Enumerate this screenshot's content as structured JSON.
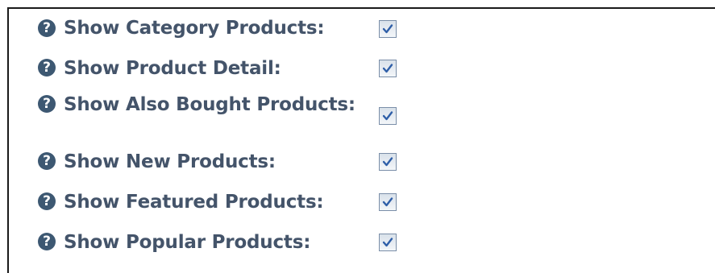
{
  "settings": {
    "rows": [
      {
        "label": "Show Category Products:",
        "checked": true
      },
      {
        "label": "Show Product Detail:",
        "checked": true
      },
      {
        "label": "Show Also Bought Products:",
        "checked": true
      },
      {
        "label": "Show New Products:",
        "checked": true
      },
      {
        "label": "Show Featured Products:",
        "checked": true
      },
      {
        "label": "Show Popular Products:",
        "checked": true
      }
    ],
    "help_icon": "help-question-icon",
    "colors": {
      "label": "#44546a",
      "help_icon": "#3d5872",
      "checkmark": "#2f5fa8",
      "border": "#1a1a1a"
    }
  }
}
